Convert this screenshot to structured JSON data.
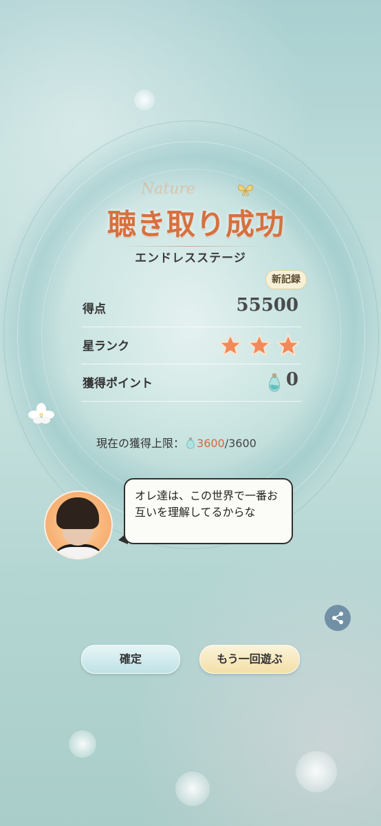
{
  "result": {
    "title": "聴き取り成功",
    "title_script": "Nature",
    "subtitle": "エンドレスステージ",
    "new_record_badge": "新記録"
  },
  "stats": {
    "score_label": "得点",
    "score_value": "55500",
    "rank_label": "星ランク",
    "rank_stars": 3,
    "points_label": "獲得ポイント",
    "points_value": "0"
  },
  "limit": {
    "label": "現在の獲得上限：",
    "current": "3600",
    "separator": "/",
    "max": "3600"
  },
  "dialogue": {
    "text": "オレ達は、この世界で一番お互いを理解してるからな"
  },
  "buttons": {
    "confirm": "確定",
    "retry": "もう一回遊ぶ"
  },
  "icons": {
    "share": "share-icon",
    "star": "star-icon",
    "point": "bottle-icon"
  },
  "colors": {
    "title": "#d7703e",
    "star": "#f08a5a",
    "limit_current": "#d06a3a"
  }
}
